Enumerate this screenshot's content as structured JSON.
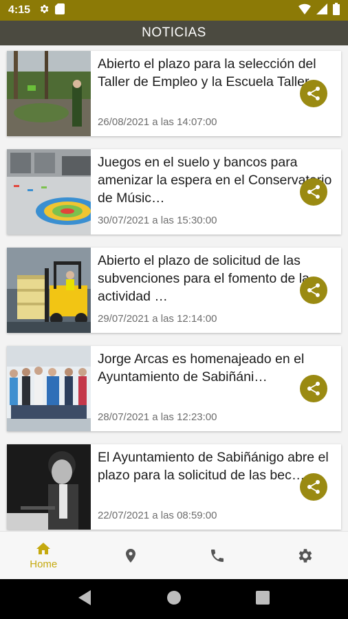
{
  "status_bar": {
    "time": "4:15"
  },
  "app_bar": {
    "title": "NOTICIAS"
  },
  "news": [
    {
      "title": "Abierto el plazo para la selección del Taller de Empleo y la Escuela Taller",
      "date": "26/08/2021 a las 14:07:00"
    },
    {
      "title": "Juegos en el suelo y bancos para amenizar la espera en el Conservatorio de Músic…",
      "date": "30/07/2021 a las 15:30:00"
    },
    {
      "title": "Abierto el plazo de solicitud de las subvenciones para el fomento de la actividad …",
      "date": "29/07/2021 a las 12:14:00"
    },
    {
      "title": "Jorge Arcas es homenajeado en el Ayuntamiento de Sabiñáni…",
      "date": "28/07/2021 a las 12:23:00"
    },
    {
      "title": "El Ayuntamiento de Sabiñánigo abre el plazo para la solicitud de las bec…",
      "date": "22/07/2021 a las 08:59:00"
    }
  ],
  "bottom_nav": {
    "home_label": "Home",
    "active": "home"
  },
  "colors": {
    "status_bar": "#8c7a06",
    "app_bar": "#4b4a40",
    "accent": "#c5a90e",
    "share_button": "#9a8a12"
  },
  "icons": {
    "share": "share-icon",
    "home": "home-icon",
    "location": "location-pin-icon",
    "phone": "phone-icon",
    "settings": "gear-icon"
  }
}
